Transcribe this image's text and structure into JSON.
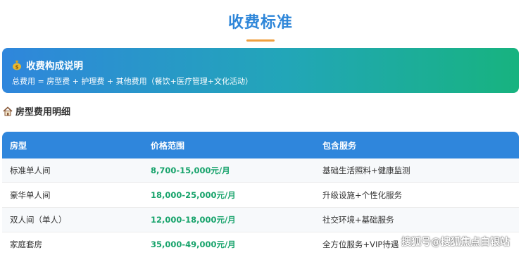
{
  "header": {
    "title": "收费标准"
  },
  "banner": {
    "icon": "money-bag-icon",
    "title": "收费构成说明",
    "description": "总费用 = 房型费 + 护理费 + 其他费用（餐饮+医疗管理+文化活动）"
  },
  "section": {
    "icon": "house-icon",
    "title": "房型费用明细"
  },
  "table": {
    "headers": [
      "房型",
      "价格范围",
      "包含服务"
    ],
    "rows": [
      {
        "room": "标准单人间",
        "price": "8,700-15,000元/月",
        "services": "基础生活照料+健康监测"
      },
      {
        "room": "豪华单人间",
        "price": "18,000-25,000元/月",
        "services": "升级设施+个性化服务"
      },
      {
        "room": "双人间（单人）",
        "price": "12,000-18,000元/月",
        "services": "社交环境+基础服务"
      },
      {
        "room": "家庭套房",
        "price": "35,000-49,000元/月",
        "services": "全方位服务+VIP待遇"
      }
    ]
  },
  "watermark": {
    "text": "搜狐号@搜狐焦点白银站"
  },
  "colors": {
    "primary": "#2f86dc",
    "accent_green": "#17a36b",
    "underline": "#f0a040"
  }
}
